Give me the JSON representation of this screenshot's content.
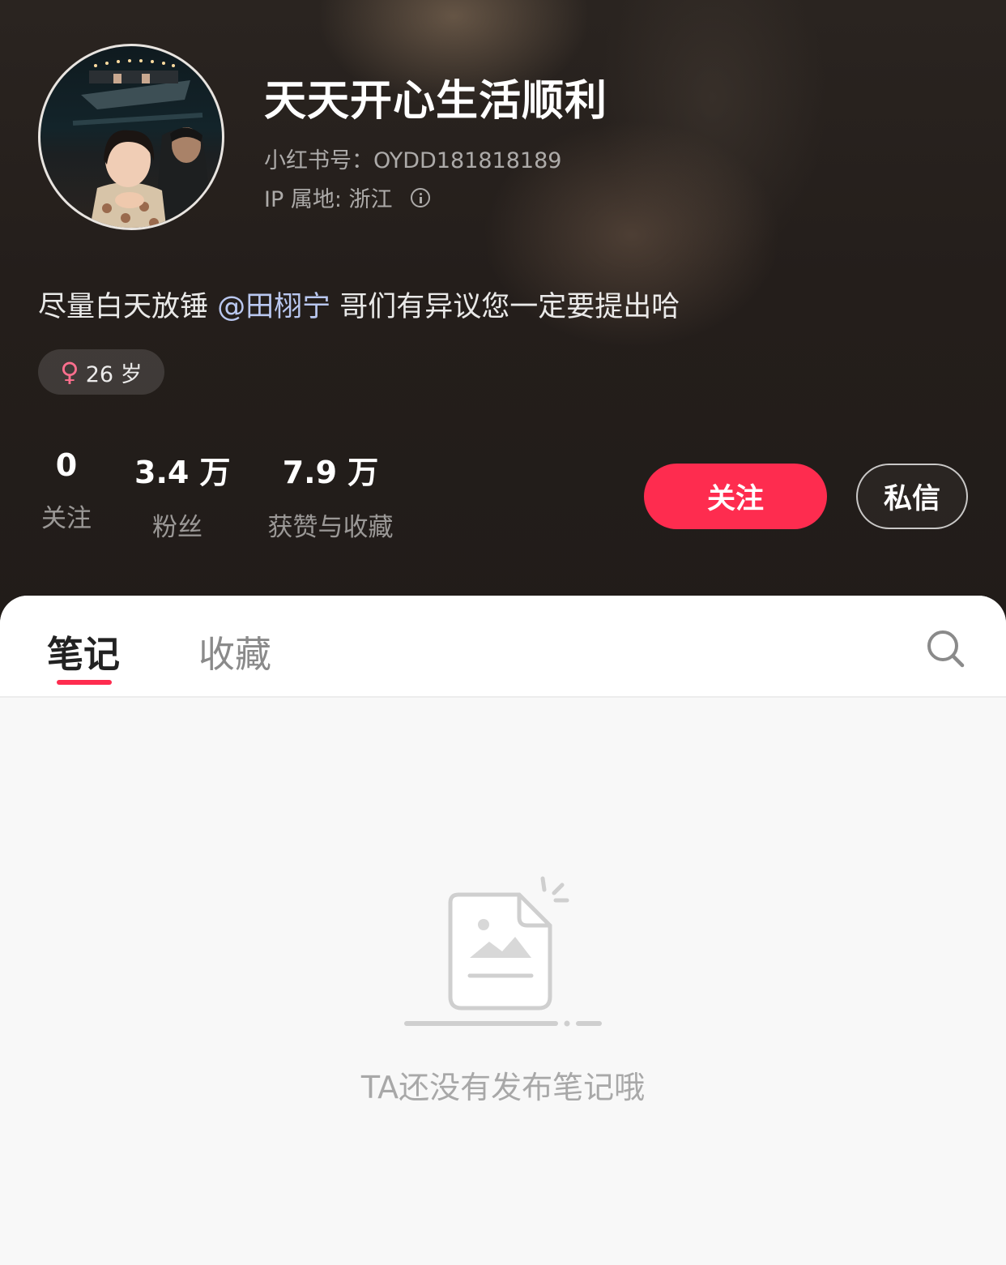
{
  "profile": {
    "nickname": "天天开心生活顺利",
    "id_line": "小红书号：OYDD181818189",
    "ip_line": "IP 属地: 浙江",
    "bio_before": "尽量白天放锤 ",
    "bio_mention": "@田栩宁",
    "bio_after": " 哥们有异议您一定要提出哈",
    "age_tag": "26 岁",
    "female_symbol": "♀"
  },
  "stats": [
    {
      "value": "0",
      "label": "关注"
    },
    {
      "value": "3.4 万",
      "label": "粉丝"
    },
    {
      "value": "7.9 万",
      "label": "获赞与收藏"
    }
  ],
  "actions": {
    "follow_label": "关注",
    "message_label": "私信"
  },
  "tabs": {
    "notes": "笔记",
    "favorites": "收藏"
  },
  "empty_state": {
    "text": "TA还没有发布笔记哦"
  },
  "colors": {
    "accent": "#fe2c4f",
    "mention": "#b9c7ef",
    "female": "#ff6f8e"
  },
  "icons": [
    "info-icon",
    "female-icon",
    "search-icon",
    "empty-note-icon"
  ]
}
